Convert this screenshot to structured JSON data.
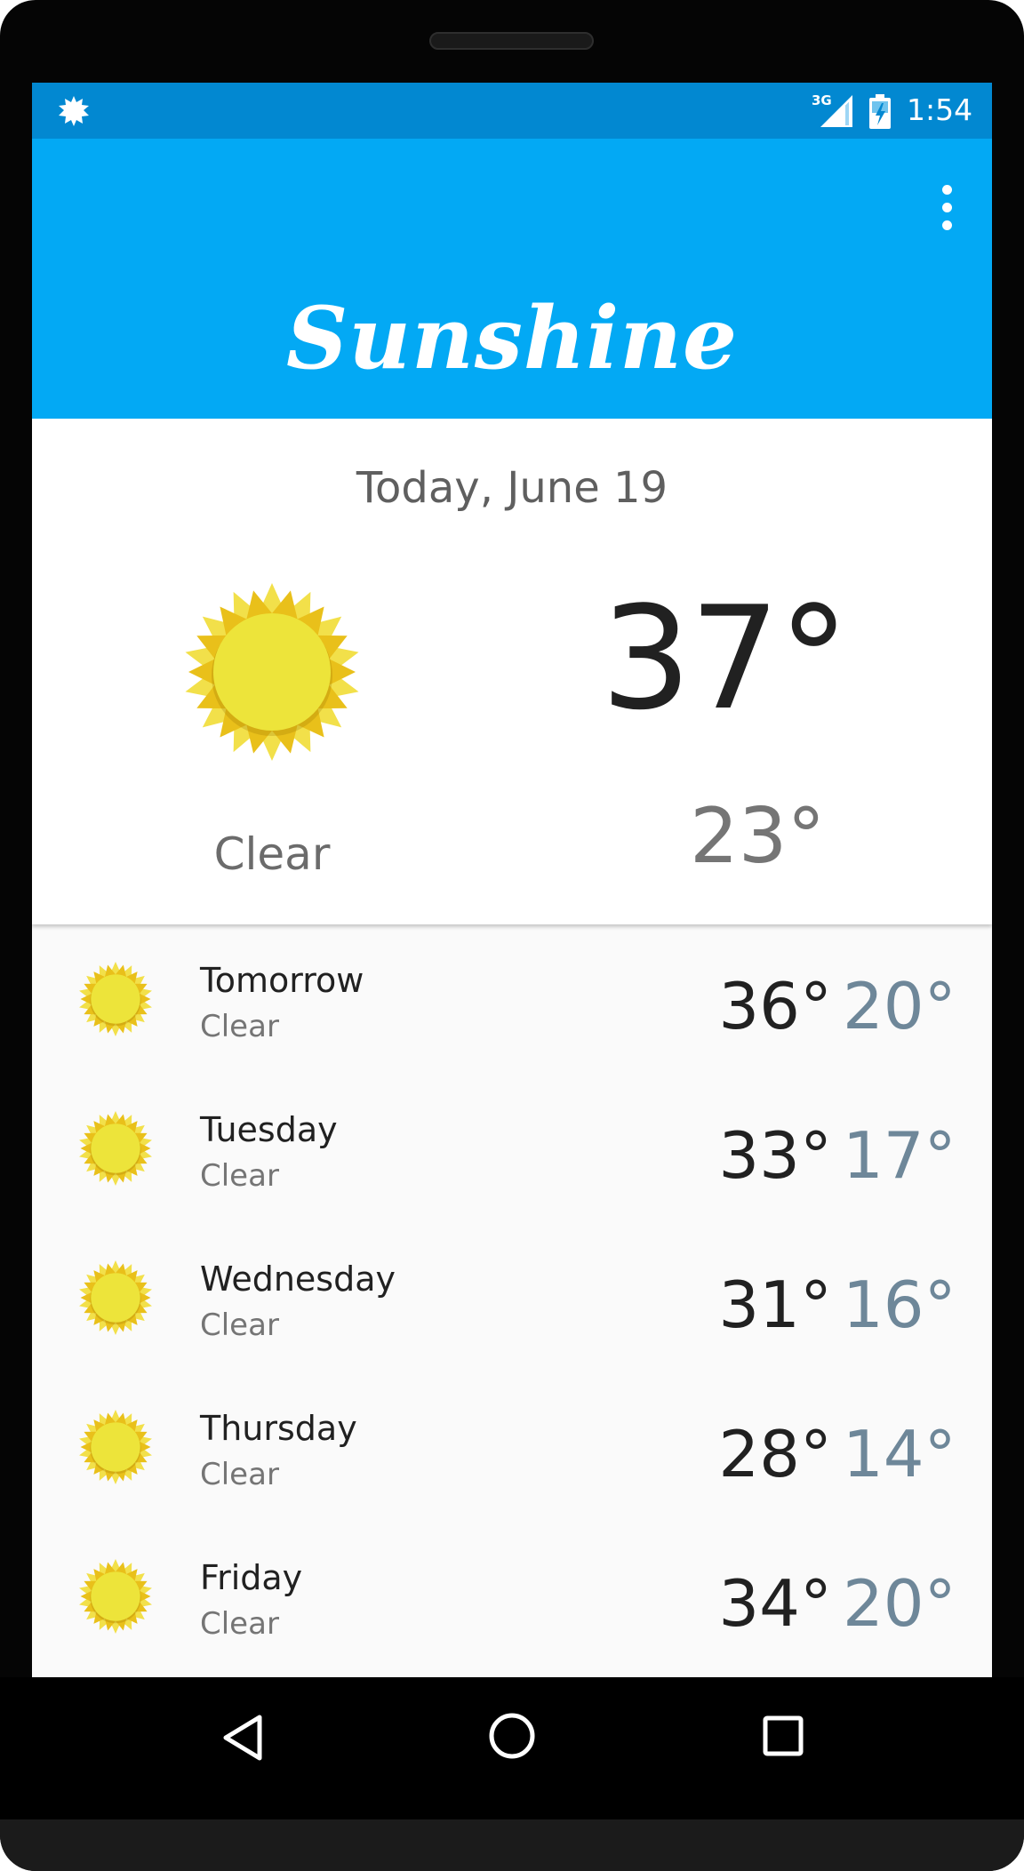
{
  "status_bar": {
    "network_label": "3G",
    "time": "1:54",
    "left_icon": "sun-notification-icon",
    "signal_icon": "signal-icon",
    "battery_icon": "battery-charging-icon",
    "color": "#0288d1"
  },
  "app_bar": {
    "title": "Sunshine",
    "menu_icon": "overflow-menu-icon",
    "color": "#03a9f4"
  },
  "today": {
    "date": "Today, June 19",
    "high": "37°",
    "low": "23°",
    "condition": "Clear",
    "icon": "sun-icon"
  },
  "forecast": [
    {
      "day": "Tomorrow",
      "condition": "Clear",
      "high": "36°",
      "low": "20°",
      "icon": "sun-icon"
    },
    {
      "day": "Tuesday",
      "condition": "Clear",
      "high": "33°",
      "low": "17°",
      "icon": "sun-icon"
    },
    {
      "day": "Wednesday",
      "condition": "Clear",
      "high": "31°",
      "low": "16°",
      "icon": "sun-icon"
    },
    {
      "day": "Thursday",
      "condition": "Clear",
      "high": "28°",
      "low": "14°",
      "icon": "sun-icon"
    },
    {
      "day": "Friday",
      "condition": "Clear",
      "high": "34°",
      "low": "20°",
      "icon": "sun-icon"
    }
  ],
  "nav_bar": {
    "back_icon": "back-icon",
    "home_icon": "home-icon",
    "recents_icon": "recents-icon"
  },
  "colors": {
    "sun_outer": "#e9c01a",
    "sun_inner": "#ede43a",
    "low_temp": "#6e8799"
  }
}
